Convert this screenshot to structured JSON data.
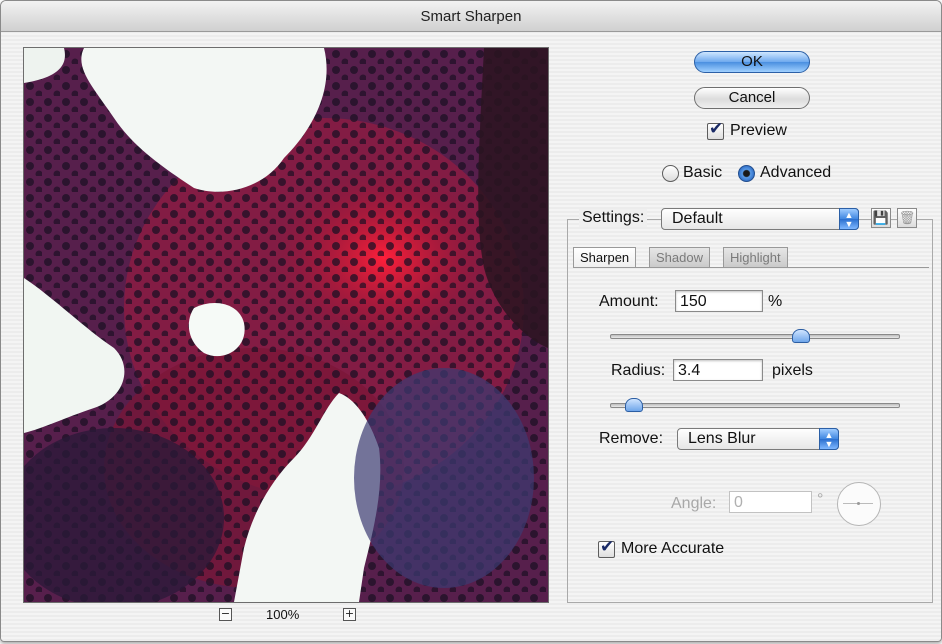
{
  "window": {
    "title": "Smart Sharpen"
  },
  "preview": {
    "zoom": "100%",
    "zoom_out_symbol": "−",
    "zoom_in_symbol": "+"
  },
  "buttons": {
    "ok": "OK",
    "cancel": "Cancel"
  },
  "preview_toggle": {
    "label": "Preview",
    "checked": true
  },
  "mode": {
    "basic_label": "Basic",
    "advanced_label": "Advanced",
    "selected": "Advanced"
  },
  "settings": {
    "label": "Settings:",
    "value": "Default"
  },
  "tabs": [
    {
      "label": "Sharpen",
      "active": true
    },
    {
      "label": "Shadow",
      "active": false
    },
    {
      "label": "Highlight",
      "active": false
    }
  ],
  "amount": {
    "label": "Amount:",
    "value": "150",
    "unit": "%",
    "slider_fraction": 0.66
  },
  "radius": {
    "label": "Radius:",
    "value": "3.4",
    "unit": "pixels",
    "slider_fraction": 0.08
  },
  "remove": {
    "label": "Remove:",
    "value": "Lens Blur"
  },
  "angle": {
    "label": "Angle:",
    "value": "0",
    "unit": "°",
    "enabled": false
  },
  "more_accurate": {
    "label": "More Accurate",
    "checked": true
  },
  "colors": {
    "accent": "#4a8fe0",
    "preview_red": "#d0182e",
    "preview_navy": "#26244e"
  }
}
